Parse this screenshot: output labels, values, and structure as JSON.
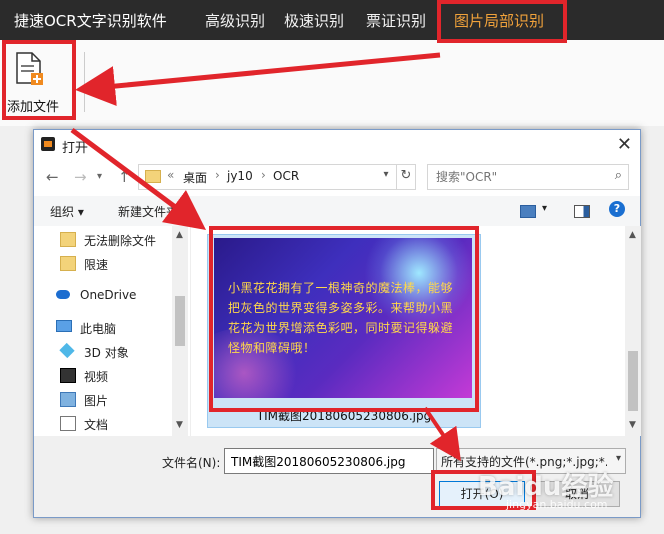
{
  "app": {
    "title": "捷速OCR文字识别软件",
    "menu": [
      "高级识别",
      "极速识别",
      "票证识别",
      "图片局部识别"
    ]
  },
  "toolbar": {
    "add_file_label": "添加文件"
  },
  "dialog": {
    "title": "打开",
    "breadcrumb": [
      "桌面",
      "jy10",
      "OCR"
    ],
    "breadcrumb_prefix": "«",
    "search_placeholder": "搜索\"OCR\"",
    "commands": {
      "organize": "组织 ▾",
      "new_folder": "新建文件夹"
    },
    "nav_items": [
      {
        "label": "无法删除文件",
        "icon": "folder-icon"
      },
      {
        "label": "限速",
        "icon": "folder-icon"
      },
      {
        "label": "OneDrive",
        "icon": "cloud-icon"
      },
      {
        "label": "此电脑",
        "icon": "computer-icon"
      },
      {
        "label": "3D 对象",
        "icon": "cube-icon"
      },
      {
        "label": "视频",
        "icon": "video-icon"
      },
      {
        "label": "图片",
        "icon": "picture-icon"
      },
      {
        "label": "文档",
        "icon": "document-icon"
      }
    ],
    "file": {
      "name": "TIM截图20180605230806.jpg",
      "preview_text": "小黑花花拥有了一根神奇的魔法棒，能够把灰色的世界变得多姿多彩。来帮助小黑花花为世界增添色彩吧，同时要记得躲避怪物和障碍哦！"
    },
    "filename_label": "文件名(N):",
    "filename_value": "TIM截图20180605230806.jpg",
    "filter_value": "所有支持的文件(*.png;*.jpg;*.bmp)",
    "open_button": "打开(O)",
    "cancel_button": "取消"
  },
  "watermark": {
    "main": "Baidu经验",
    "sub": "jingyan.baidu.com"
  },
  "colors": {
    "highlight": "#e1252b",
    "active_menu": "#f0a23b",
    "topbar": "#2b2b2b"
  }
}
